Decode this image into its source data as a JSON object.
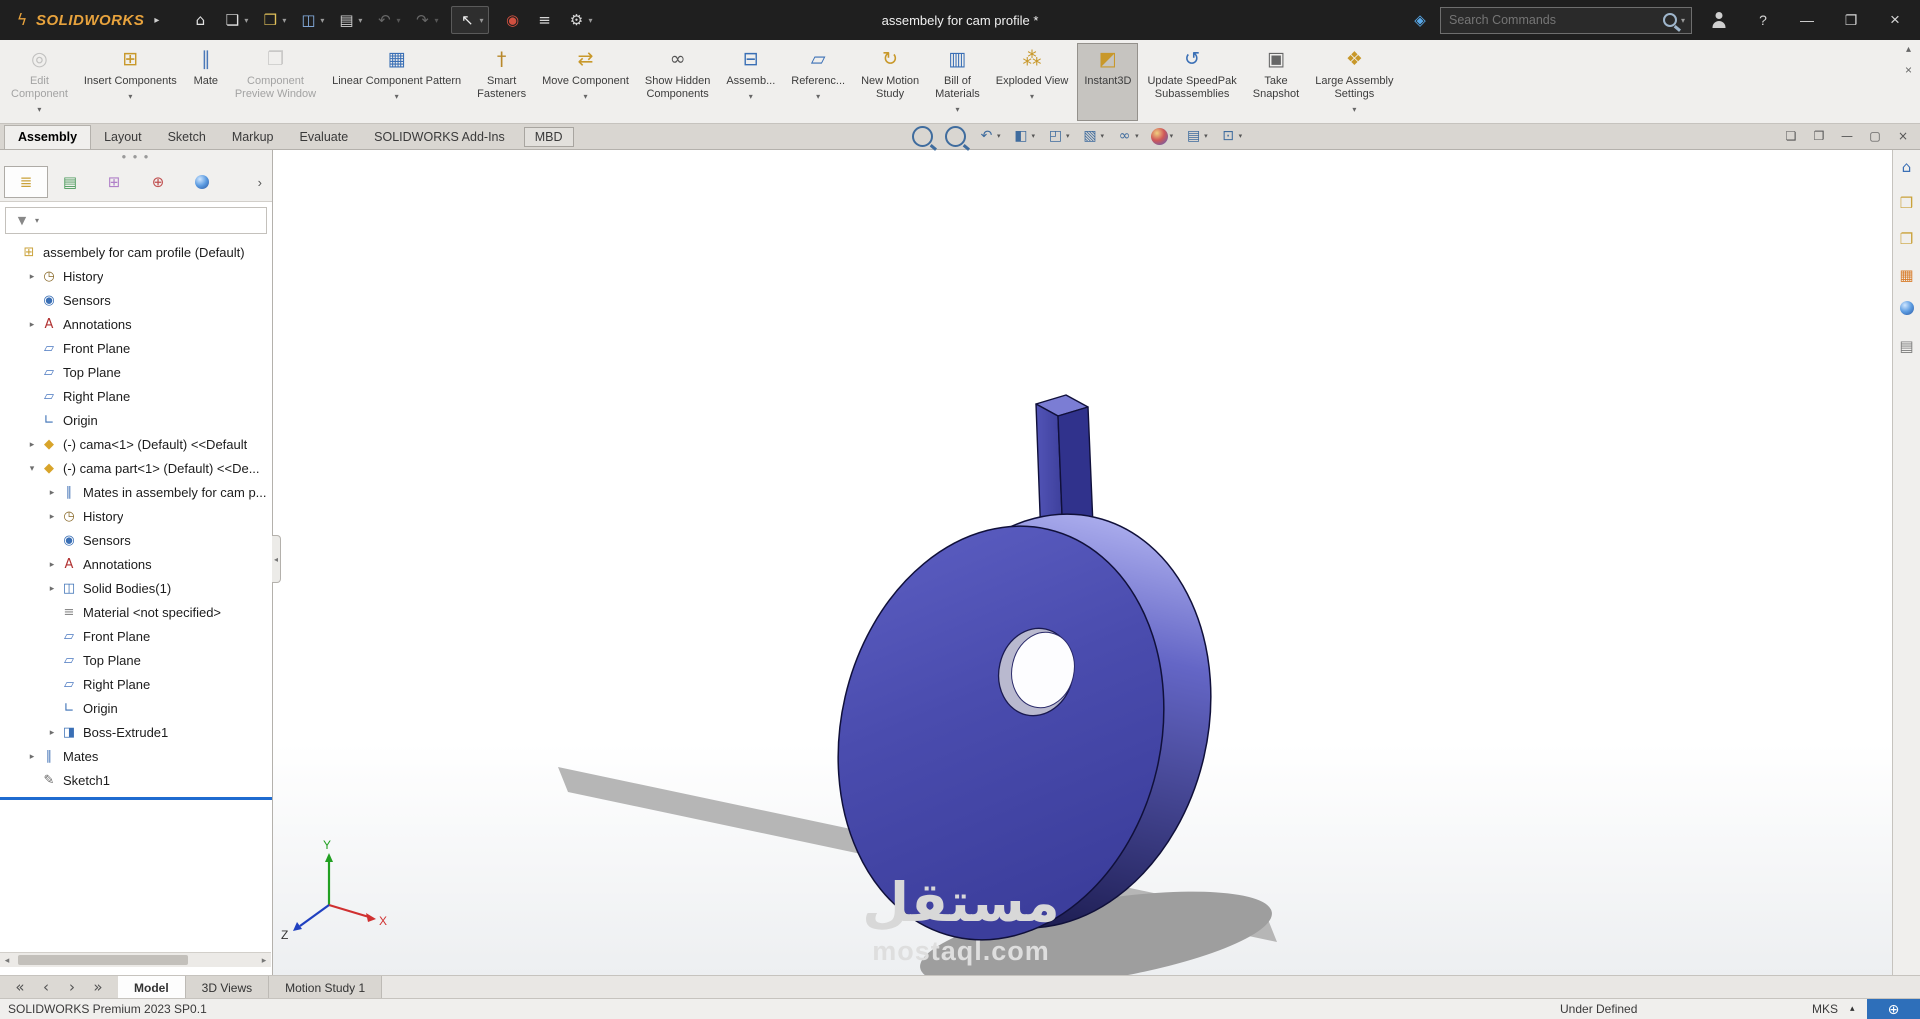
{
  "titlebar": {
    "logo": "SOLIDWORKS",
    "title": "assembely for cam profile *",
    "search_placeholder": "Search Commands",
    "tools": [
      {
        "name": "home",
        "icon": "home-icon"
      },
      {
        "name": "new-document",
        "icon": "new-document-icon",
        "dropdown": true
      },
      {
        "name": "open",
        "icon": "open-icon",
        "dropdown": true
      },
      {
        "name": "save",
        "icon": "save-icon",
        "dropdown": true
      },
      {
        "name": "print",
        "icon": "print-icon",
        "dropdown": true
      },
      {
        "name": "undo",
        "icon": "undo-icon",
        "dropdown": true,
        "disabled": true
      },
      {
        "name": "redo",
        "icon": "redo-icon",
        "dropdown": true,
        "disabled": true
      },
      {
        "name": "select",
        "icon": "select-cursor-icon",
        "dropdown": true,
        "boxed": true
      },
      {
        "name": "marketplace",
        "icon": "marketplace-icon"
      },
      {
        "name": "file-list",
        "icon": "file-list-icon"
      },
      {
        "name": "options",
        "icon": "options-gear-icon",
        "dropdown": true
      }
    ]
  },
  "ribbon": {
    "buttons": [
      {
        "name": "edit-component",
        "icon": "edit-component-icon",
        "lines": [
          "Edit",
          "Component"
        ],
        "disabled": true,
        "dropdown": true
      },
      {
        "name": "insert-components",
        "icon": "insert-components-icon",
        "lines": [
          "Insert Components"
        ],
        "dropdown": true
      },
      {
        "name": "mate",
        "icon": "mate-icon",
        "lines": [
          "Mate"
        ]
      },
      {
        "name": "component-preview-window",
        "icon": "component-preview-icon",
        "lines": [
          "Component",
          "Preview Window"
        ],
        "disabled": true
      },
      {
        "name": "linear-component-pattern",
        "icon": "linear-pattern-icon",
        "lines": [
          "Linear Component Pattern"
        ],
        "dropdown": true
      },
      {
        "name": "smart-fasteners",
        "icon": "smart-fasteners-icon",
        "lines": [
          "Smart",
          "Fasteners"
        ]
      },
      {
        "name": "move-component",
        "icon": "move-component-icon",
        "lines": [
          "Move Component"
        ],
        "dropdown": true
      },
      {
        "name": "show-hidden-components",
        "icon": "show-hidden-icon",
        "lines": [
          "Show Hidden",
          "Components"
        ]
      },
      {
        "name": "assembly-features",
        "icon": "assembly-features-icon",
        "lines": [
          "Assemb..."
        ],
        "dropdown": true
      },
      {
        "name": "reference-geometry",
        "icon": "reference-geometry-icon",
        "lines": [
          "Referenc..."
        ],
        "dropdown": true
      },
      {
        "name": "new-motion-study",
        "icon": "motion-study-icon",
        "lines": [
          "New Motion",
          "Study"
        ]
      },
      {
        "name": "bill-of-materials",
        "icon": "bom-icon",
        "lines": [
          "Bill of",
          "Materials"
        ],
        "dropdown": true
      },
      {
        "name": "exploded-view",
        "icon": "exploded-view-icon",
        "lines": [
          "Exploded View"
        ],
        "dropdown": true
      },
      {
        "name": "instant3d",
        "icon": "instant3d-icon",
        "lines": [
          "Instant3D"
        ],
        "active": true
      },
      {
        "name": "update-speedpak-subassemblies",
        "icon": "speedpak-icon",
        "lines": [
          "Update SpeedPak",
          "Subassemblies"
        ]
      },
      {
        "name": "take-snapshot",
        "icon": "snapshot-icon",
        "lines": [
          "Take",
          "Snapshot"
        ]
      },
      {
        "name": "large-assembly-settings",
        "icon": "large-assembly-icon",
        "lines": [
          "Large Assembly",
          "Settings"
        ],
        "dropdown": true
      }
    ]
  },
  "command_tabs": [
    {
      "label": "Assembly",
      "active": true
    },
    {
      "label": "Layout"
    },
    {
      "label": "Sketch"
    },
    {
      "label": "Markup"
    },
    {
      "label": "Evaluate"
    },
    {
      "label": "SOLIDWORKS Add-Ins"
    },
    {
      "label": "MBD",
      "boxed": true
    }
  ],
  "doc_window_controls": [
    {
      "name": "pane-preview",
      "icon": "pane-preview-icon"
    },
    {
      "name": "pane-split",
      "icon": "pane-split-icon"
    },
    {
      "name": "doc-minimize",
      "icon": "minimize-icon"
    },
    {
      "name": "doc-restore",
      "icon": "restore-icon"
    },
    {
      "name": "doc-close",
      "icon": "close-icon"
    }
  ],
  "feature_tree": {
    "panel_tabs": [
      {
        "name": "featuremanager",
        "icon": "featuremanager-icon",
        "active": true
      },
      {
        "name": "propertymanager",
        "icon": "propertymanager-icon"
      },
      {
        "name": "configurationmanager",
        "icon": "configurationmanager-icon"
      },
      {
        "name": "dimxpertmanager",
        "icon": "dimxpert-icon"
      },
      {
        "name": "displaymanager",
        "icon": "displaymanager-icon"
      }
    ],
    "items": [
      {
        "label": "assembely for cam profile (Default)",
        "icon": "assembly-icon",
        "level": 0,
        "expander": ""
      },
      {
        "label": "History",
        "icon": "history-icon",
        "level": 1,
        "expander": "right"
      },
      {
        "label": "Sensors",
        "icon": "sensors-icon",
        "level": 1,
        "expander": ""
      },
      {
        "label": "Annotations",
        "icon": "annotations-icon",
        "level": 1,
        "expander": "right"
      },
      {
        "label": "Front Plane",
        "icon": "plane-icon",
        "level": 1,
        "expander": ""
      },
      {
        "label": "Top Plane",
        "icon": "plane-icon",
        "level": 1,
        "expander": ""
      },
      {
        "label": "Right Plane",
        "icon": "plane-icon",
        "level": 1,
        "expander": ""
      },
      {
        "label": "Origin",
        "icon": "origin-icon",
        "level": 1,
        "expander": ""
      },
      {
        "label": "(-) cama<1> (Default) <<Default",
        "icon": "part-icon",
        "level": 1,
        "expander": "right"
      },
      {
        "label": "(-) cama part<1> (Default) <<De...",
        "icon": "part-icon",
        "level": 1,
        "expander": "down"
      },
      {
        "label": "Mates in assembely for cam p...",
        "icon": "mates-group-icon",
        "level": 2,
        "expander": "right"
      },
      {
        "label": "History",
        "icon": "history-icon",
        "level": 2,
        "expander": "right"
      },
      {
        "label": "Sensors",
        "icon": "sensors-icon",
        "level": 2,
        "expander": ""
      },
      {
        "label": "Annotations",
        "icon": "annotations-icon",
        "level": 2,
        "expander": "right"
      },
      {
        "label": "Solid Bodies(1)",
        "icon": "solid-bodies-icon",
        "level": 2,
        "expander": "right"
      },
      {
        "label": "Material <not specified>",
        "icon": "material-icon",
        "level": 2,
        "expander": ""
      },
      {
        "label": "Front Plane",
        "icon": "plane-icon",
        "level": 2,
        "expander": ""
      },
      {
        "label": "Top Plane",
        "icon": "plane-icon",
        "level": 2,
        "expander": ""
      },
      {
        "label": "Right Plane",
        "icon": "plane-icon",
        "level": 2,
        "expander": ""
      },
      {
        "label": "Origin",
        "icon": "origin-icon",
        "level": 2,
        "expander": ""
      },
      {
        "label": "Boss-Extrude1",
        "icon": "boss-extrude-icon",
        "level": 2,
        "expander": "right"
      },
      {
        "label": "Mates",
        "icon": "mates-icon",
        "level": 1,
        "expander": "right"
      },
      {
        "label": "Sketch1",
        "icon": "sketch-icon",
        "level": 1,
        "expander": ""
      }
    ]
  },
  "viewport": {
    "toolbar": [
      {
        "name": "zoom-to-fit",
        "icon": "zoom-fit-icon"
      },
      {
        "name": "zoom-to-area",
        "icon": "zoom-area-icon"
      },
      {
        "name": "previous-view",
        "icon": "previous-view-icon",
        "dropdown": true
      },
      {
        "name": "section-view",
        "icon": "section-view-icon",
        "dropdown": true
      },
      {
        "name": "view-orientation",
        "icon": "orientation-icon",
        "dropdown": true
      },
      {
        "name": "display-style",
        "icon": "display-style-icon",
        "dropdown": true
      },
      {
        "name": "hide-show-items",
        "icon": "hide-show-icon",
        "dropdown": true
      },
      {
        "name": "edit-appearance",
        "icon": "appearance-ball-icon",
        "dropdown": true
      },
      {
        "name": "apply-scene",
        "icon": "scene-icon",
        "dropdown": true
      },
      {
        "name": "view-settings",
        "icon": "view-settings-icon",
        "dropdown": true
      }
    ],
    "triad": {
      "x": "X",
      "y": "Y",
      "z": "Z"
    },
    "watermark": {
      "line1": "مستقل",
      "line2": "mostaql.com"
    },
    "model_colors": {
      "cam_front": "#4a4cae",
      "cam_rim_light": "#a9abec",
      "cam_rim_dark": "#1c1c50",
      "follower": "#4e50b2",
      "edge": "#10103a",
      "shadow": "#b6b6b6"
    }
  },
  "task_pane": [
    {
      "name": "taskpane-home",
      "icon": "taskpane-home-icon"
    },
    {
      "name": "design-library",
      "icon": "design-library-icon"
    },
    {
      "name": "file-explorer",
      "icon": "file-explorer-icon"
    },
    {
      "name": "view-palette",
      "icon": "view-palette-icon"
    },
    {
      "name": "appearances",
      "icon": "appearances-icon"
    },
    {
      "name": "custom-properties",
      "icon": "custom-properties-icon"
    }
  ],
  "bottom_tabs": {
    "nav": [
      {
        "name": "first-tab",
        "icon": "first-icon"
      },
      {
        "name": "previous-tab",
        "icon": "previous-icon"
      },
      {
        "name": "next-tab",
        "icon": "next-icon"
      },
      {
        "name": "last-tab",
        "icon": "last-icon"
      }
    ],
    "tabs": [
      {
        "label": "Model",
        "active": true
      },
      {
        "label": "3D Views"
      },
      {
        "label": "Motion Study 1"
      }
    ]
  },
  "status_bar": {
    "left": "SOLIDWORKS Premium 2023 SP0.1",
    "state": "Under Defined",
    "units": "MKS"
  }
}
